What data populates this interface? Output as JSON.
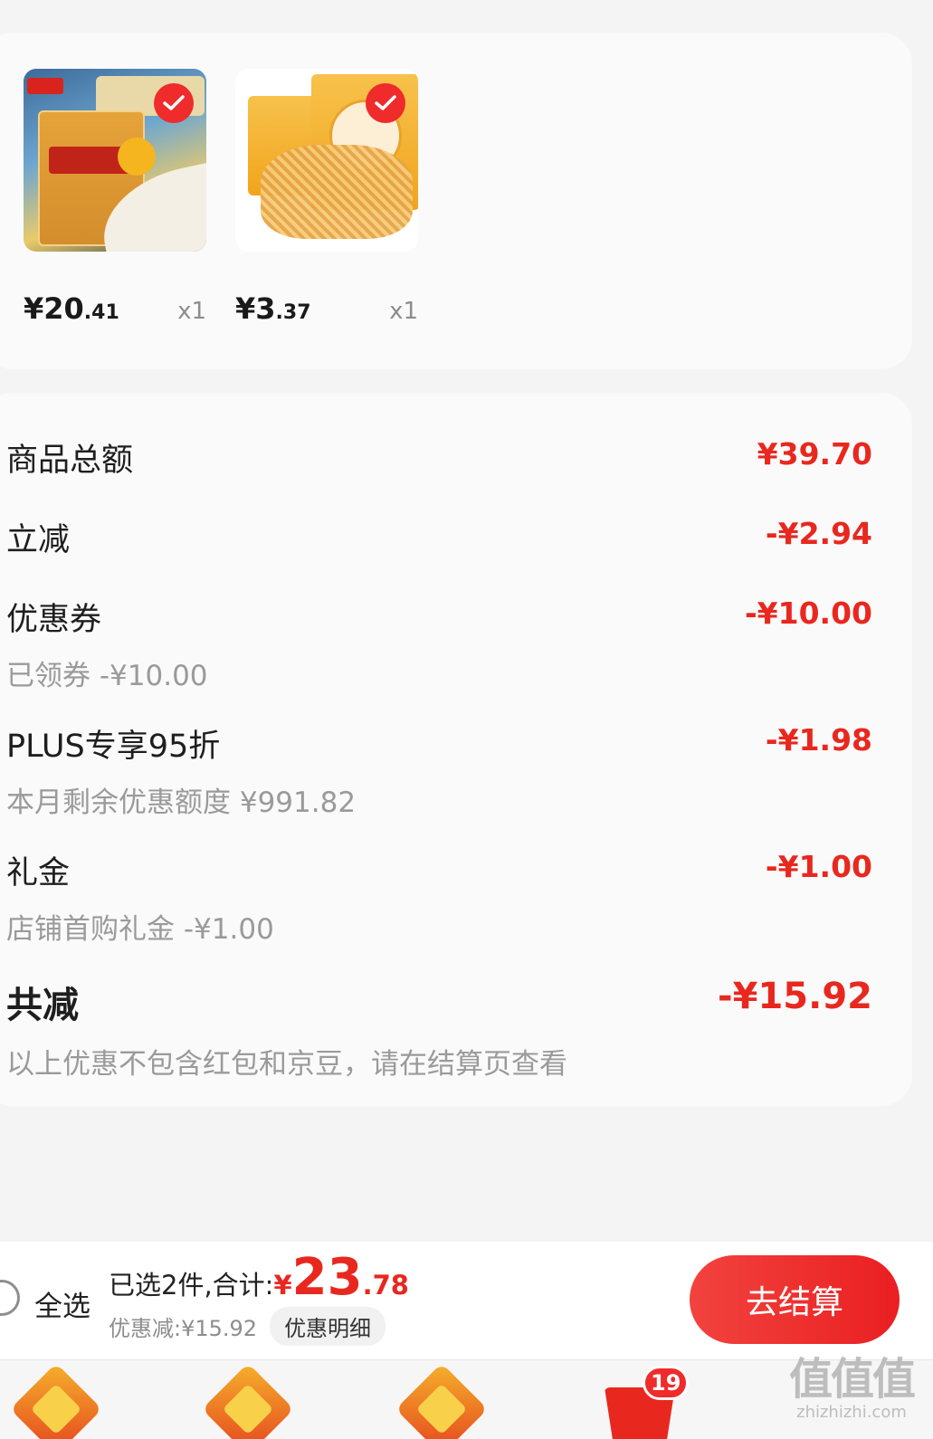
{
  "products": [
    {
      "name": "rice",
      "price_int": "¥20",
      "price_dec": ".41",
      "qty": "x1"
    },
    {
      "name": "noodles",
      "price_int": "¥3",
      "price_dec": ".37",
      "qty": "x1"
    }
  ],
  "summary": {
    "goods_total": {
      "label": "商品总额",
      "value": "¥39.70"
    },
    "instant_discount": {
      "label": "立减",
      "value": "-¥2.94"
    },
    "coupon": {
      "label": "优惠券",
      "value": "-¥10.00",
      "sub": "已领券 -¥10.00"
    },
    "plus": {
      "label": "PLUS专享95折",
      "value": "-¥1.98",
      "sub": "本月剩余优惠额度 ¥991.82"
    },
    "gift": {
      "label": "礼金",
      "value": "-¥1.00",
      "sub": "店铺首购礼金 -¥1.00"
    },
    "total_discount": {
      "label": "共减",
      "value": "-¥15.92",
      "sub": "以上优惠不包含红包和京豆，请在结算页查看"
    }
  },
  "checkout": {
    "select_all_label": "全选",
    "selected_text": "已选2件,合计:",
    "currency": "¥",
    "total_int": "23",
    "total_dec": ".78",
    "discount_text": "优惠减:¥15.92",
    "detail_label": "优惠明细",
    "checkout_label": "去结算"
  },
  "tabbar": {
    "cart_badge": "19"
  },
  "watermark": {
    "big": "值值值",
    "small": "zhizhizhi.com"
  },
  "colors": {
    "accent_red": "#e8281f",
    "check_red": "#ef2b2b"
  }
}
